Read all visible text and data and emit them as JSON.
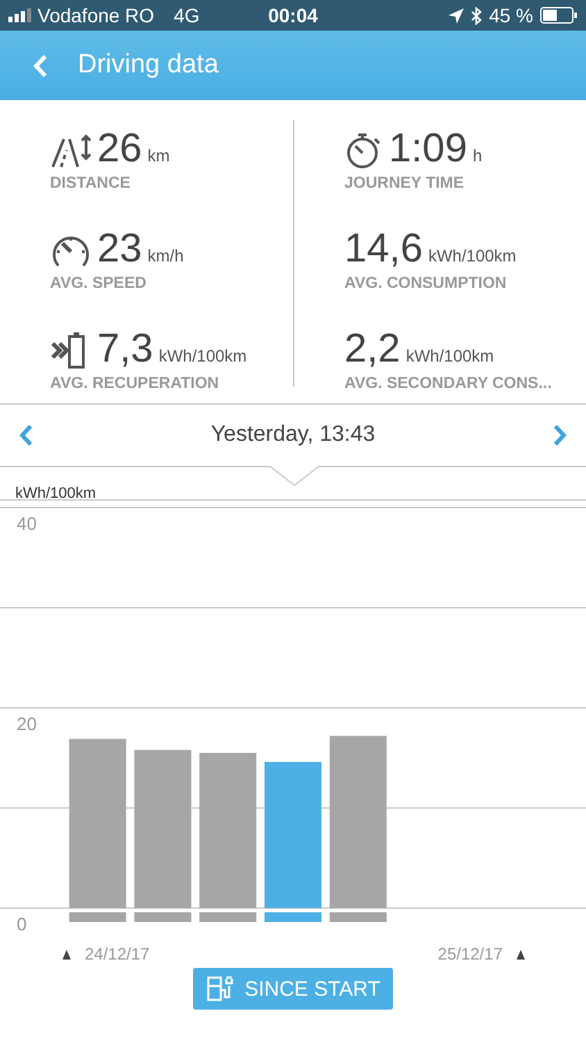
{
  "status_bar": {
    "carrier": "Vodafone RO",
    "network": "4G",
    "time": "00:04",
    "battery": "45 %"
  },
  "header": {
    "title": "Driving data"
  },
  "stats": [
    {
      "kind": "distance",
      "value": "26",
      "unit": "km",
      "label": "DISTANCE"
    },
    {
      "kind": "time",
      "value": "1:09",
      "unit": "h",
      "label": "JOURNEY TIME"
    },
    {
      "kind": "speed",
      "value": "23",
      "unit": "km/h",
      "label": "AVG. SPEED"
    },
    {
      "kind": "plain",
      "value": "14,6",
      "unit": "kWh/100km",
      "label": "AVG. CONSUMPTION"
    },
    {
      "kind": "recuperation",
      "value": "7,3",
      "unit": "kWh/100km",
      "label": "AVG. RECUPERATION"
    },
    {
      "kind": "plain",
      "value": "2,2",
      "unit": "kWh/100km",
      "label": "AVG. SECONDARY CONS..."
    }
  ],
  "trip_nav": {
    "title": "Yesterday, 13:43"
  },
  "chart": {
    "unit_label": "kWh/100km",
    "bars": [
      {
        "selected": false
      },
      {
        "selected": false
      },
      {
        "selected": false
      },
      {
        "selected": true
      },
      {
        "selected": false
      }
    ],
    "chart_data": {
      "type": "bar",
      "categories": [
        null,
        null,
        null,
        null,
        null,
        null,
        null,
        null,
        null
      ],
      "series": [
        {
          "color": "#a6a6a6",
          "values": [
            null,
            16.9,
            15.8,
            15.5,
            null,
            17.2,
            null,
            null,
            null
          ]
        },
        {
          "color": "#4db0e4",
          "values": [
            null,
            null,
            null,
            null,
            14.6,
            null,
            null,
            null,
            null
          ]
        }
      ],
      "ylim": [
        0,
        40
      ],
      "yticks": [
        0,
        20,
        40
      ]
    },
    "start_date": "24/12/17",
    "end_date": "25/12/17"
  },
  "button": {
    "label": "SINCE START"
  }
}
